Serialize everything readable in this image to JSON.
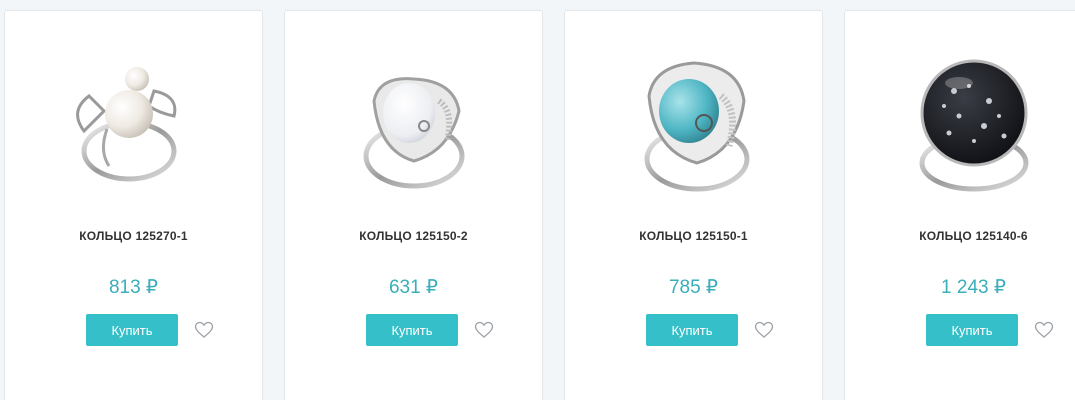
{
  "currency_symbol": "₽",
  "colors": {
    "accent": "#35bfc9",
    "price": "#3aaeb9",
    "background": "#f3f6f9"
  },
  "products": [
    {
      "name": "КОЛЬЦО 125270-1",
      "price": "813 ₽",
      "buy_label": "Купить",
      "image": "pearl-ring",
      "favorite_icon": "heart-outline-icon"
    },
    {
      "name": "КОЛЬЦО 125150-2",
      "price": "631 ₽",
      "buy_label": "Купить",
      "image": "mother-of-pearl-ring",
      "favorite_icon": "heart-outline-icon"
    },
    {
      "name": "КОЛЬЦО 125150-1",
      "price": "785 ₽",
      "buy_label": "Купить",
      "image": "turquoise-ring",
      "favorite_icon": "heart-outline-icon"
    },
    {
      "name": "КОЛЬЦО 125140-6",
      "price": "1 243 ₽",
      "buy_label": "Купить",
      "image": "obsidian-ring",
      "favorite_icon": "heart-outline-icon"
    }
  ]
}
